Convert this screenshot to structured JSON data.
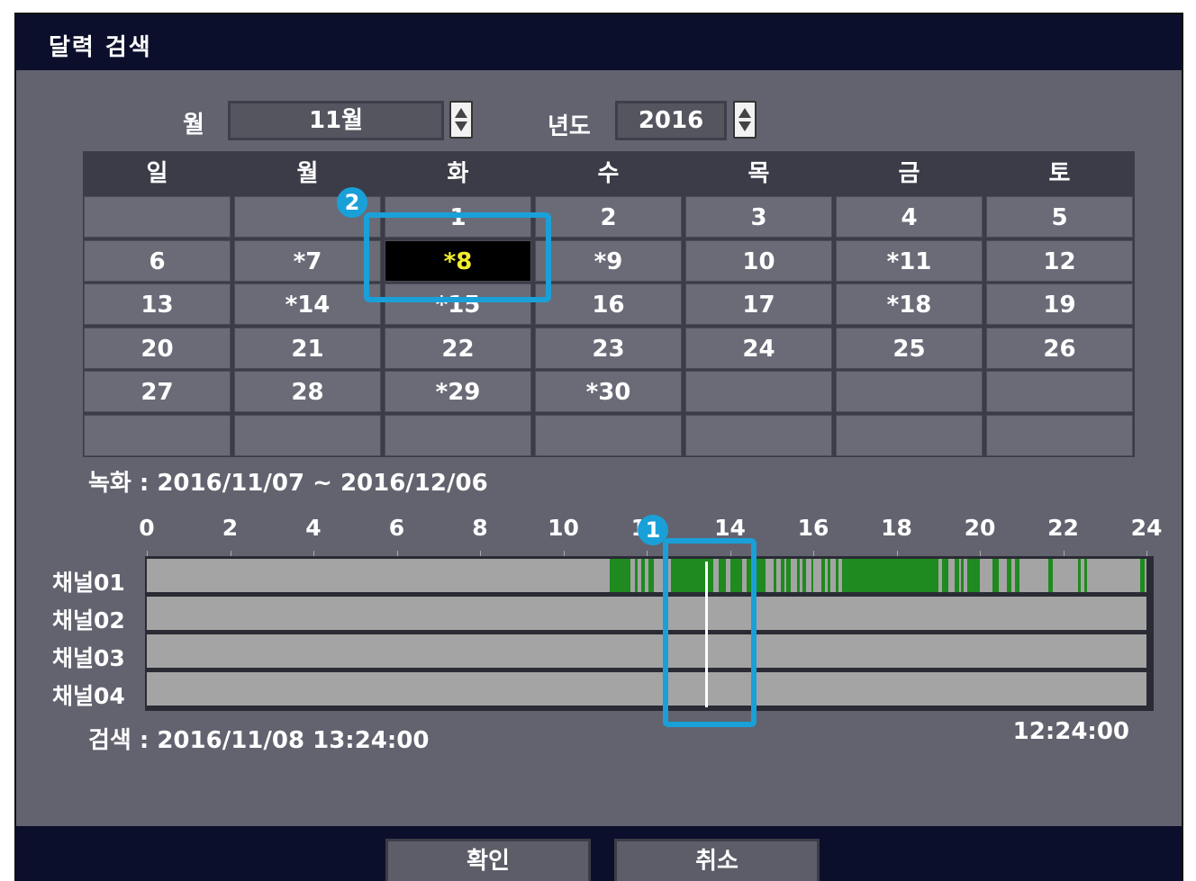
{
  "window": {
    "title": "달력 검색"
  },
  "month": {
    "label": "월",
    "value": "11월"
  },
  "year": {
    "label": "년도",
    "value": "2016"
  },
  "calendar": {
    "weekdays": [
      "일",
      "월",
      "화",
      "수",
      "목",
      "금",
      "토"
    ],
    "rows": [
      [
        "",
        "",
        "1",
        "2",
        "3",
        "4",
        "5"
      ],
      [
        "6",
        "*7",
        "*8",
        "*9",
        "10",
        "*11",
        "12"
      ],
      [
        "13",
        "*14",
        "*15",
        "16",
        "17",
        "*18",
        "19"
      ],
      [
        "20",
        "21",
        "22",
        "23",
        "24",
        "25",
        "26"
      ],
      [
        "27",
        "28",
        "*29",
        "*30",
        "",
        "",
        ""
      ],
      [
        "",
        "",
        "",
        "",
        "",
        "",
        ""
      ]
    ],
    "selected_day": "*8"
  },
  "recording_range": "녹화 : 2016/11/07 ~ 2016/12/06",
  "timeline": {
    "hour_ticks": [
      "0",
      "2",
      "4",
      "6",
      "8",
      "10",
      "12",
      "14",
      "16",
      "18",
      "20",
      "22",
      "24"
    ],
    "channels": [
      "채널01",
      "채널02",
      "채널03",
      "채널04"
    ],
    "cursor_hour": 13.4,
    "channel01_recordings_hours": [
      [
        11.12,
        11.62
      ],
      [
        11.72,
        11.78
      ],
      [
        11.88,
        11.95
      ],
      [
        12.05,
        12.18
      ],
      [
        12.58,
        13.6
      ],
      [
        13.72,
        13.9
      ],
      [
        14.0,
        14.3
      ],
      [
        14.4,
        14.85
      ],
      [
        15.05,
        15.12
      ],
      [
        15.22,
        15.3
      ],
      [
        15.35,
        15.45
      ],
      [
        15.6,
        15.68
      ],
      [
        15.75,
        15.82
      ],
      [
        15.95,
        16.0
      ],
      [
        16.2,
        16.28
      ],
      [
        16.35,
        16.42
      ],
      [
        16.55,
        16.6
      ],
      [
        16.7,
        19.0
      ],
      [
        19.1,
        19.25
      ],
      [
        19.4,
        19.5
      ],
      [
        19.55,
        19.6
      ],
      [
        19.7,
        20.0
      ],
      [
        20.3,
        20.45
      ],
      [
        20.65,
        20.75
      ],
      [
        20.85,
        20.95
      ],
      [
        21.65,
        21.75
      ],
      [
        22.35,
        22.42
      ],
      [
        22.5,
        22.58
      ],
      [
        23.85,
        23.95
      ]
    ]
  },
  "search": {
    "datetime": "검색 : 2016/11/08 13:24:00",
    "clock": "12:24:00"
  },
  "buttons": {
    "ok": "확인",
    "cancel": "취소"
  },
  "annotations": {
    "badge_1": "1",
    "badge_2": "2"
  },
  "colors": {
    "highlight": "#1aa0d8",
    "recording": "#1f8a1f",
    "selected_text": "#f3ee2c"
  }
}
